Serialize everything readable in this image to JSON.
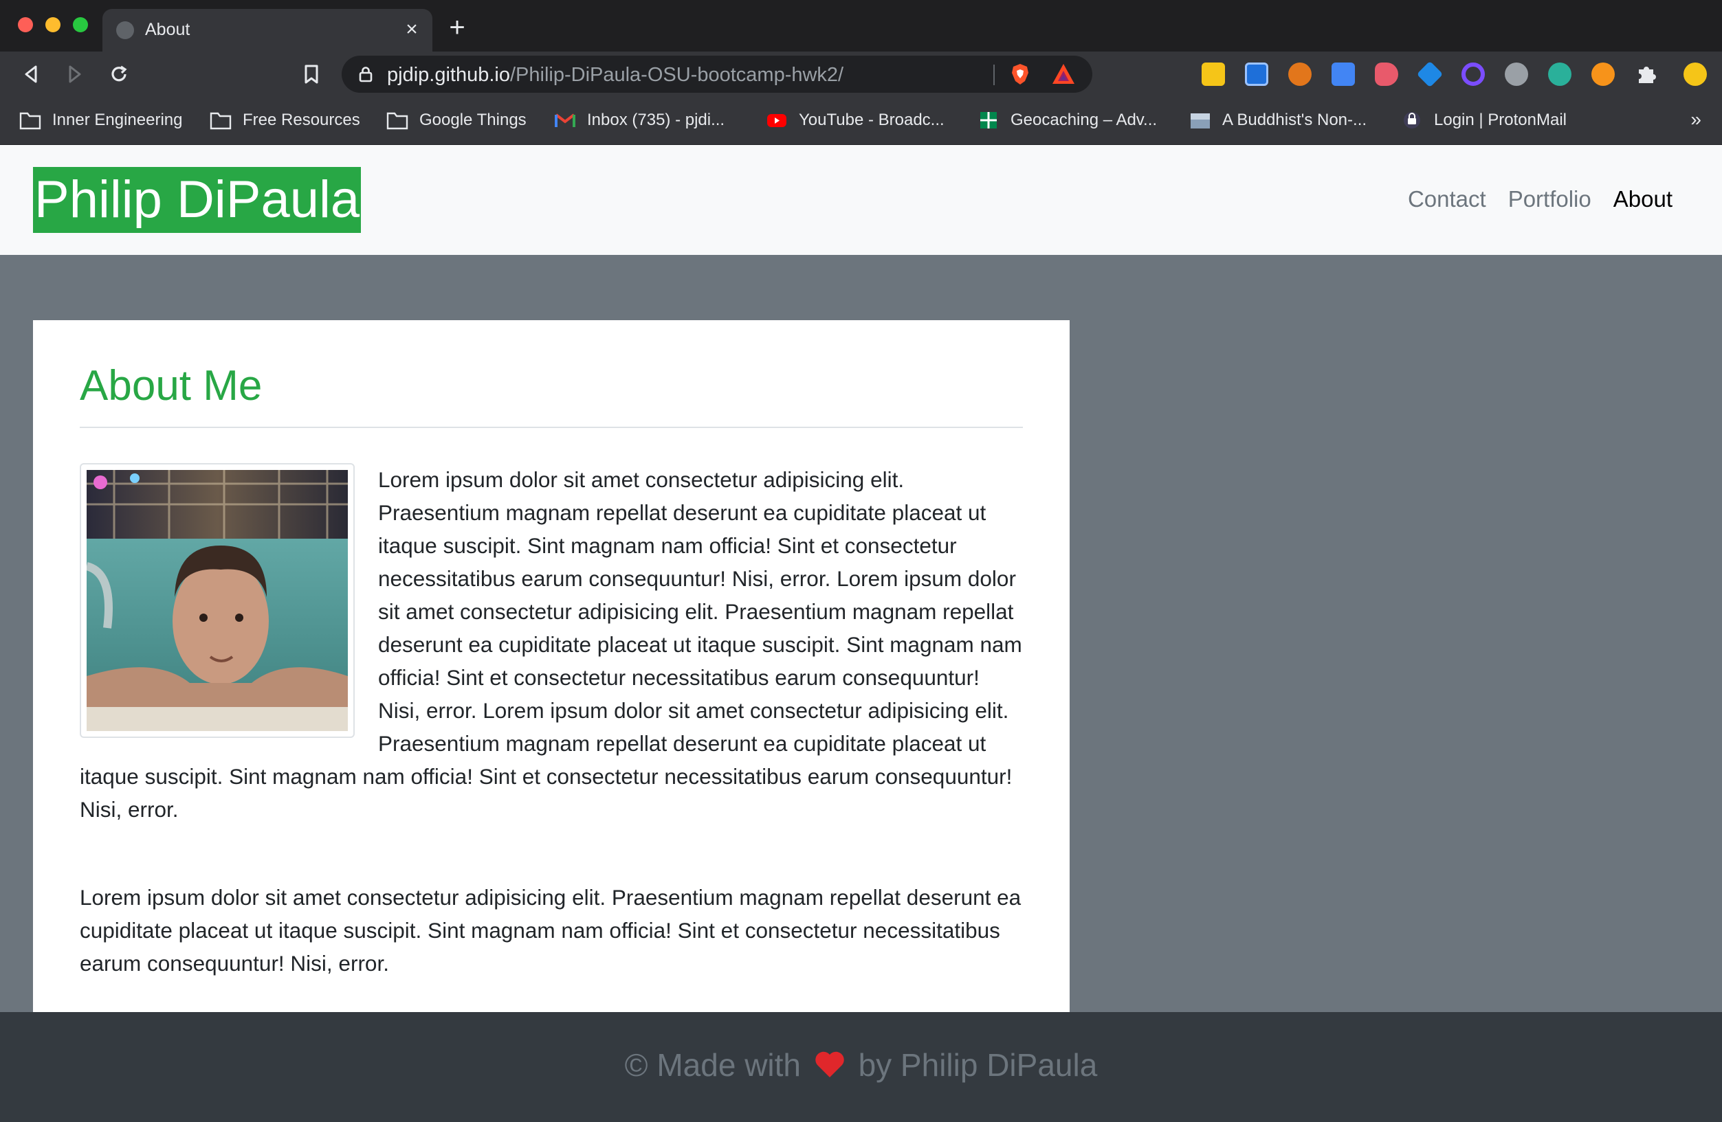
{
  "browser": {
    "tab": {
      "title": "About",
      "favicon": "globe-icon"
    },
    "url": {
      "host": "pjdip.github.io",
      "path": "/Philip-DiPaula-OSU-bootcamp-hwk2/"
    },
    "bookmarks": [
      {
        "label": "Inner Engineering",
        "icon": "folder-icon"
      },
      {
        "label": "Free Resources",
        "icon": "folder-icon"
      },
      {
        "label": "Google Things",
        "icon": "folder-icon"
      },
      {
        "label": "Inbox (735) - pjdi...",
        "icon": "gmail-icon"
      },
      {
        "label": "YouTube - Broadc...",
        "icon": "youtube-icon"
      },
      {
        "label": "Geocaching – Adv...",
        "icon": "geocaching-icon"
      },
      {
        "label": "A Buddhist's Non-...",
        "icon": "image-icon"
      },
      {
        "label": "Login | ProtonMail",
        "icon": "protonmail-icon"
      }
    ],
    "bookmarks_overflow": "»"
  },
  "site": {
    "brand": "Philip DiPaula",
    "nav": [
      {
        "label": "Contact",
        "active": false
      },
      {
        "label": "Portfolio",
        "active": false
      },
      {
        "label": "About",
        "active": true
      }
    ],
    "about": {
      "title": "About Me",
      "photo": "profile-photo",
      "paragraphs": [
        "Lorem ipsum dolor sit amet consectetur adipisicing elit. Praesentium magnam repellat deserunt ea cupiditate placeat ut itaque suscipit. Sint magnam nam officia! Sint et consectetur necessitatibus earum consequuntur! Nisi, error. Lorem ipsum dolor sit amet consectetur adipisicing elit. Praesentium magnam repellat deserunt ea cupiditate placeat ut itaque suscipit. Sint magnam nam officia! Sint et consectetur necessitatibus earum consequuntur! Nisi, error. Lorem ipsum dolor sit amet consectetur adipisicing elit. Praesentium magnam repellat deserunt ea cupiditate placeat ut itaque suscipit. Sint magnam nam officia! Sint et consectetur necessitatibus earum consequuntur! Nisi, error.",
        "Lorem ipsum dolor sit amet consectetur adipisicing elit. Praesentium magnam repellat deserunt ea cupiditate placeat ut itaque suscipit. Sint magnam nam officia! Sint et consectetur necessitatibus earum consequuntur! Nisi, error."
      ]
    },
    "footer": {
      "prefix": "© Made with",
      "suffix": "by Philip DiPaula"
    }
  },
  "colors": {
    "brand_green": "#28a745",
    "page_bg": "#6c757d",
    "footer_bg": "#343a40",
    "navbar_bg": "#f8f9fa",
    "heart": "#e0272b"
  }
}
